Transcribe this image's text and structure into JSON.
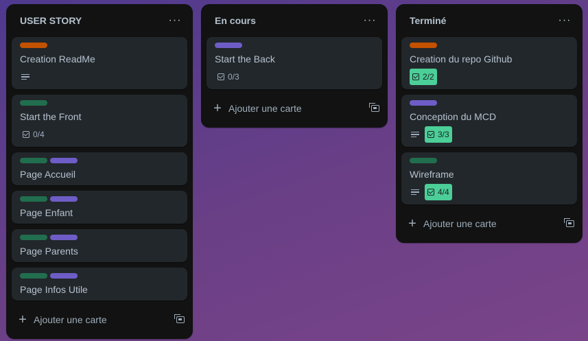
{
  "colors": {
    "orange": "#c25100",
    "green": "#216e4e",
    "purple": "#6e5dc6",
    "checklist_done": "#4bce97"
  },
  "add_card_label": "Ajouter une carte",
  "menu_glyph": "···",
  "lists": [
    {
      "title": "USER STORY",
      "cards": [
        {
          "title": "Creation ReadMe",
          "labels": [
            "orange"
          ],
          "has_description": true
        },
        {
          "title": "Start the Front",
          "labels": [
            "green"
          ],
          "checklist": "0/4"
        },
        {
          "title": "Page Accueil",
          "labels": [
            "green",
            "purple"
          ]
        },
        {
          "title": "Page Enfant",
          "labels": [
            "green",
            "purple"
          ]
        },
        {
          "title": "Page Parents",
          "labels": [
            "green",
            "purple"
          ]
        },
        {
          "title": "Page Infos Utile",
          "labels": [
            "green",
            "purple"
          ]
        }
      ]
    },
    {
      "title": "En cours",
      "cards": [
        {
          "title": "Start the Back",
          "labels": [
            "purple"
          ],
          "checklist": "0/3"
        }
      ]
    },
    {
      "title": "Terminé",
      "cards": [
        {
          "title": "Creation du repo Github",
          "labels": [
            "orange"
          ],
          "checklist": "2/2",
          "checklist_done": true
        },
        {
          "title": "Conception du MCD",
          "labels": [
            "purple"
          ],
          "has_description": true,
          "checklist": "3/3",
          "checklist_done": true
        },
        {
          "title": "Wireframe",
          "labels": [
            "green"
          ],
          "has_description": true,
          "checklist": "4/4",
          "checklist_done": true
        }
      ]
    }
  ]
}
